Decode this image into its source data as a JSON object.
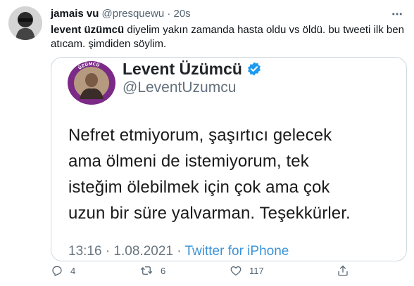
{
  "tweet": {
    "author": {
      "display_name": "jamais vu",
      "handle": "@presquewu",
      "separator": "·",
      "time": "20s"
    },
    "text": {
      "mention": "levent üzümcü",
      "body": " diyelim yakın zamanda hasta oldu vs öldü. bu tweeti ilk ben atıcam. şimdiden söylim."
    },
    "more_icon": "more-horizontal-icon"
  },
  "quoted": {
    "display_name": "Levent Üzümcü",
    "verified_icon": "verified-badge-icon",
    "handle": "@LeventUzumcu",
    "lines": [
      "Nefret etmiyorum, şaşırtıcı gelecek",
      "ama ölmeni de istemiyorum, tek",
      "isteğim ölebilmek için çok ama çok",
      "uzun bir süre yalvarman. Teşekkürler."
    ],
    "footer": {
      "datetime": "13:16 · 1.08.2021 · ",
      "app": "Twitter for iPhone"
    },
    "avatar_ring_text": "ÜZÜMCÜ"
  },
  "actions": {
    "reply": {
      "icon": "reply-icon",
      "count": "4"
    },
    "retweet": {
      "icon": "retweet-icon",
      "count": "6"
    },
    "like": {
      "icon": "like-icon",
      "count": "117"
    },
    "share": {
      "icon": "share-icon"
    }
  },
  "colors": {
    "text": "#0f1419",
    "secondary": "#536471",
    "border": "#cfd9de",
    "verified": "#1d9bf0",
    "link": "#3b93d6",
    "avatar_ring": "#7b2a86"
  }
}
